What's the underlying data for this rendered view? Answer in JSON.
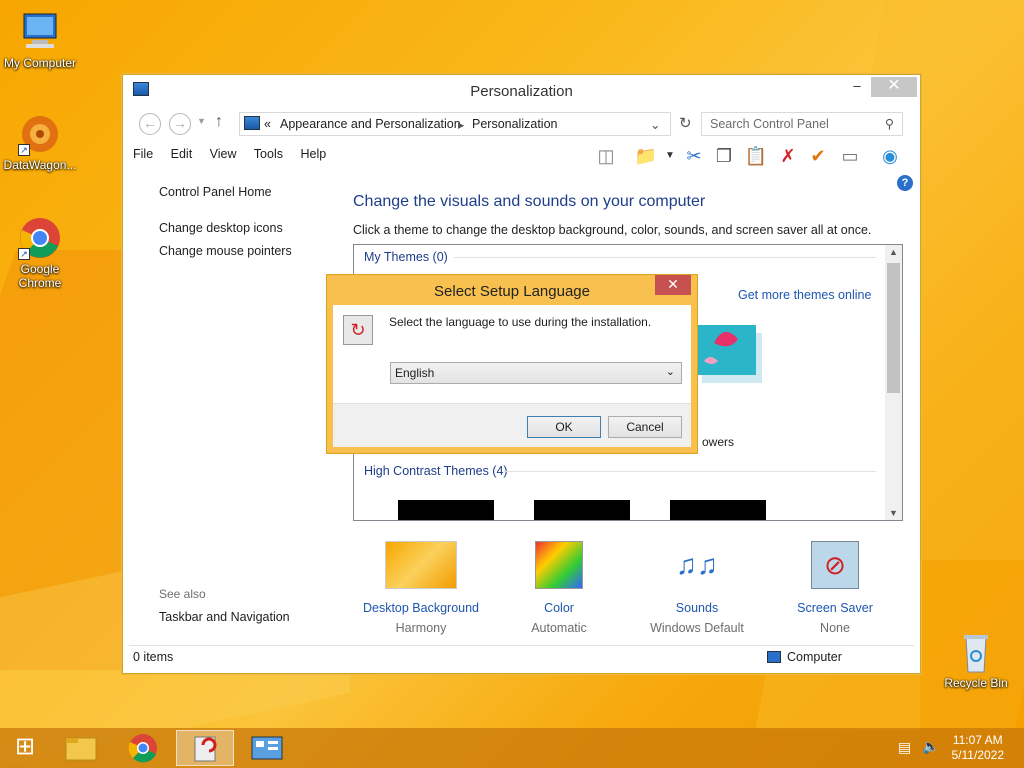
{
  "desktop": {
    "icons": [
      {
        "label": "My Computer"
      },
      {
        "label": "DataWagon..."
      },
      {
        "label": "Google Chrome"
      },
      {
        "label": "Recycle Bin"
      }
    ]
  },
  "window": {
    "title": "Personalization",
    "breadcrumb": {
      "prefix": "«",
      "part1": "Appearance and Personalization",
      "part2": "Personalization"
    },
    "search_placeholder": "Search Control Panel",
    "menu": [
      "File",
      "Edit",
      "View",
      "Tools",
      "Help"
    ],
    "left_pane": {
      "home": "Control Panel Home",
      "links": [
        "Change desktop icons",
        "Change mouse pointers"
      ],
      "see_also": "See also",
      "see_also_link": "Taskbar and Navigation"
    },
    "main": {
      "heading": "Change the visuals and sounds on your computer",
      "subtext": "Click a theme to change the desktop background, color, sounds, and screen saver all at once.",
      "my_themes": "My Themes (0)",
      "more_themes": "Get more themes online",
      "flowers_label": "owers",
      "high_contrast": "High Contrast Themes (4)"
    },
    "bottom": [
      {
        "link": "Desktop Background",
        "value": "Harmony"
      },
      {
        "link": "Color",
        "value": "Automatic"
      },
      {
        "link": "Sounds",
        "value": "Windows Default"
      },
      {
        "link": "Screen Saver",
        "value": "None"
      }
    ],
    "status": {
      "items": "0 items",
      "location": "Computer"
    }
  },
  "dialog": {
    "title": "Select Setup Language",
    "message": "Select the language to use during the installation.",
    "selected_language": "English",
    "ok": "OK",
    "cancel": "Cancel"
  },
  "taskbar": {
    "time": "11:07 AM",
    "date": "5/11/2022"
  }
}
